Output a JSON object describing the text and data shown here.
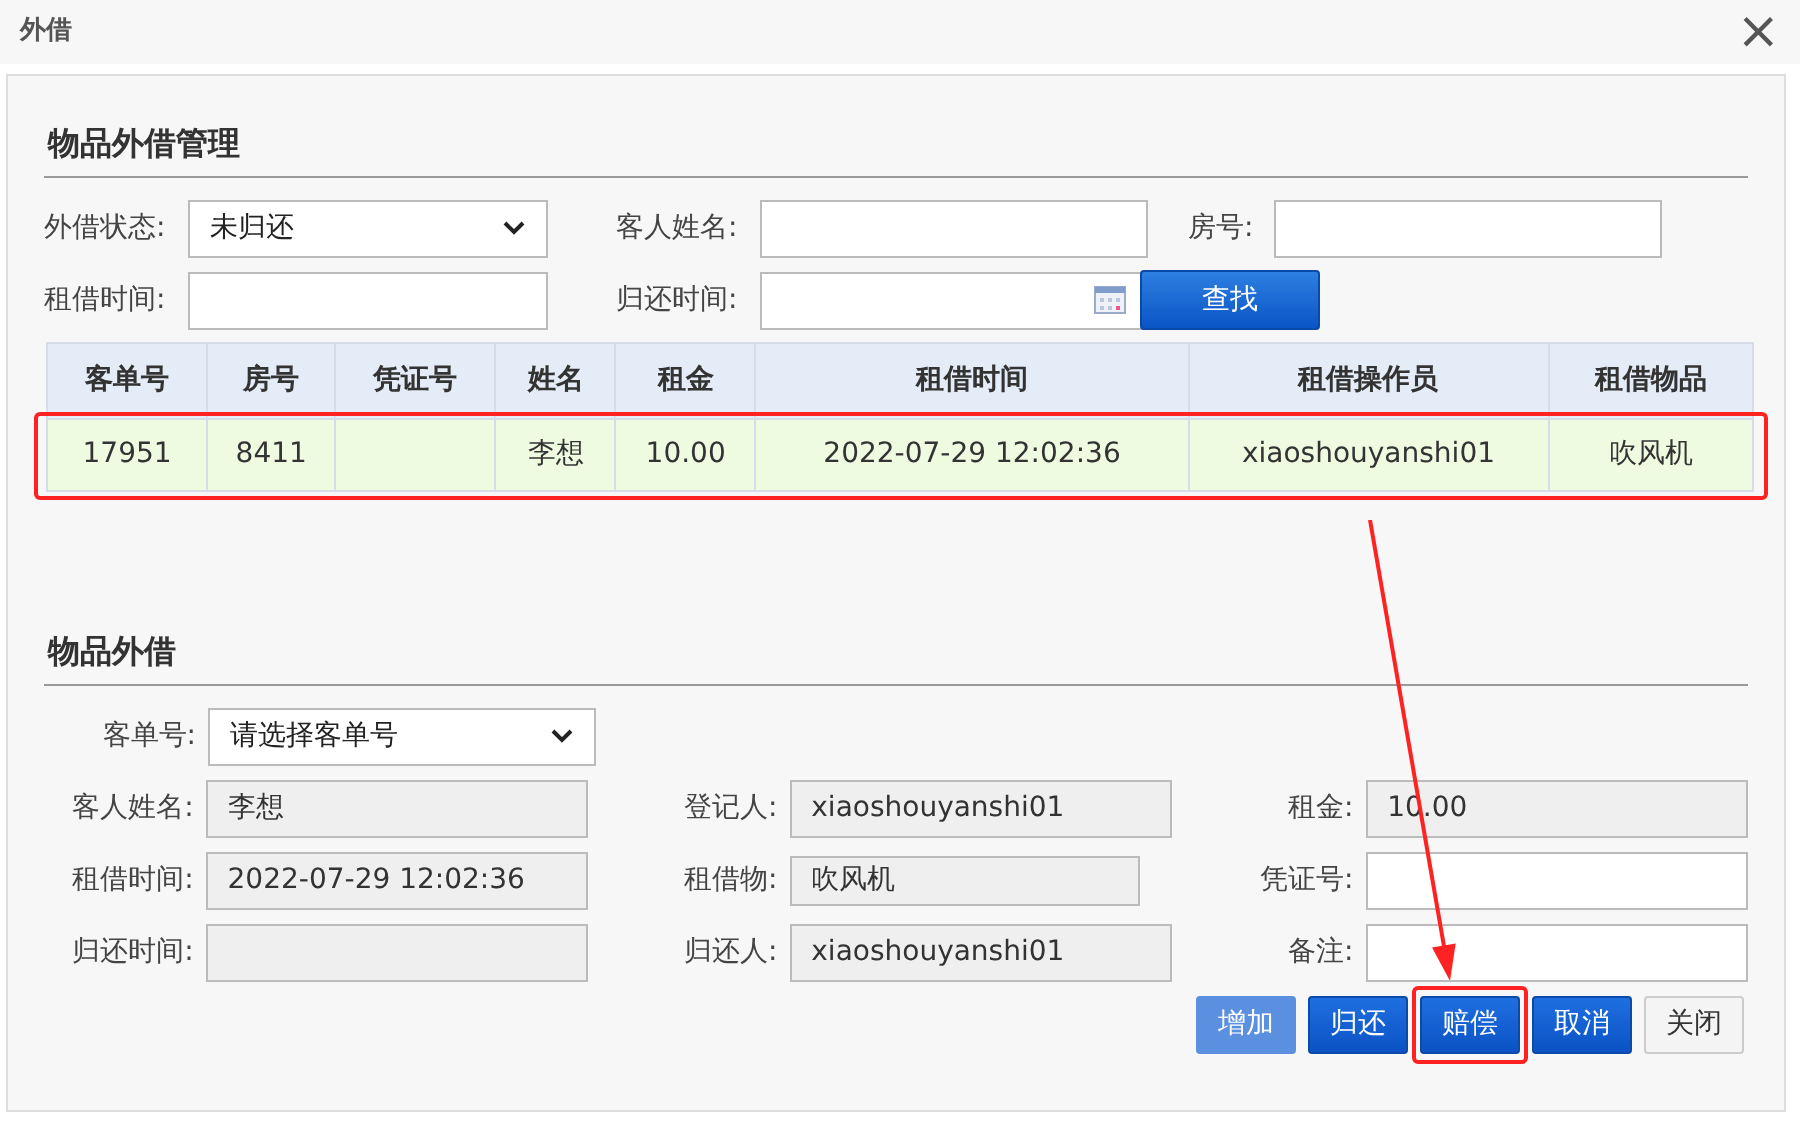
{
  "window": {
    "title": "外借",
    "close": "×"
  },
  "search": {
    "title": "物品外借管理",
    "fields": [
      {
        "label": "外借状态:",
        "kind": "select",
        "value": "未归还"
      },
      {
        "label": "客人姓名:",
        "kind": "input"
      },
      {
        "label": "房号:",
        "kind": "input"
      },
      {
        "label": "租借时间:",
        "kind": "input"
      },
      {
        "label": "归还时间:",
        "kind": "date"
      }
    ],
    "button": "查找"
  },
  "table": {
    "columns": [
      "客单号",
      "房号",
      "凭证号",
      "姓名",
      "租金",
      "租借时间",
      "租借操作员",
      "租借物品"
    ],
    "rows": [
      {
        "cells": [
          "17951",
          "8411",
          "",
          "李想",
          "10.00",
          "2022-07-29 12:02:36",
          "xiaoshouyanshi01",
          "吹风机"
        ],
        "selected": true,
        "highlighted": true
      }
    ]
  },
  "lend": {
    "title": "物品外借",
    "order": {
      "label": "客单号:",
      "value": "请选择客单号"
    },
    "fields": [
      {
        "label": "客人姓名:",
        "value": "李想",
        "disabled": true
      },
      {
        "label": "登记人:",
        "value": "xiaoshouyanshi01",
        "disabled": true
      },
      {
        "label": "租金:",
        "value": "10.00",
        "disabled": true
      },
      {
        "label": "租借时间:",
        "value": "2022-07-29 12:02:36",
        "disabled": true
      },
      {
        "label": "租借物:",
        "value": "吹风机",
        "disabled": true
      },
      {
        "label": "凭证号:",
        "disabled": false
      },
      {
        "label": "归还时间:",
        "disabled": true
      },
      {
        "label": "归还人:",
        "value": "xiaoshouyanshi01",
        "disabled": true
      },
      {
        "label": "备注:",
        "disabled": false
      }
    ],
    "buttons": [
      {
        "label": "增加",
        "kind": "primary",
        "disabled": true,
        "highlighted": false
      },
      {
        "label": "归还",
        "kind": "primary",
        "disabled": false,
        "highlighted": false
      },
      {
        "label": "赔偿",
        "kind": "primary",
        "disabled": false,
        "highlighted": true
      },
      {
        "label": "取消",
        "kind": "primary",
        "disabled": false,
        "highlighted": false
      },
      {
        "label": "关闭",
        "kind": "default",
        "disabled": false,
        "highlighted": false
      }
    ]
  }
}
